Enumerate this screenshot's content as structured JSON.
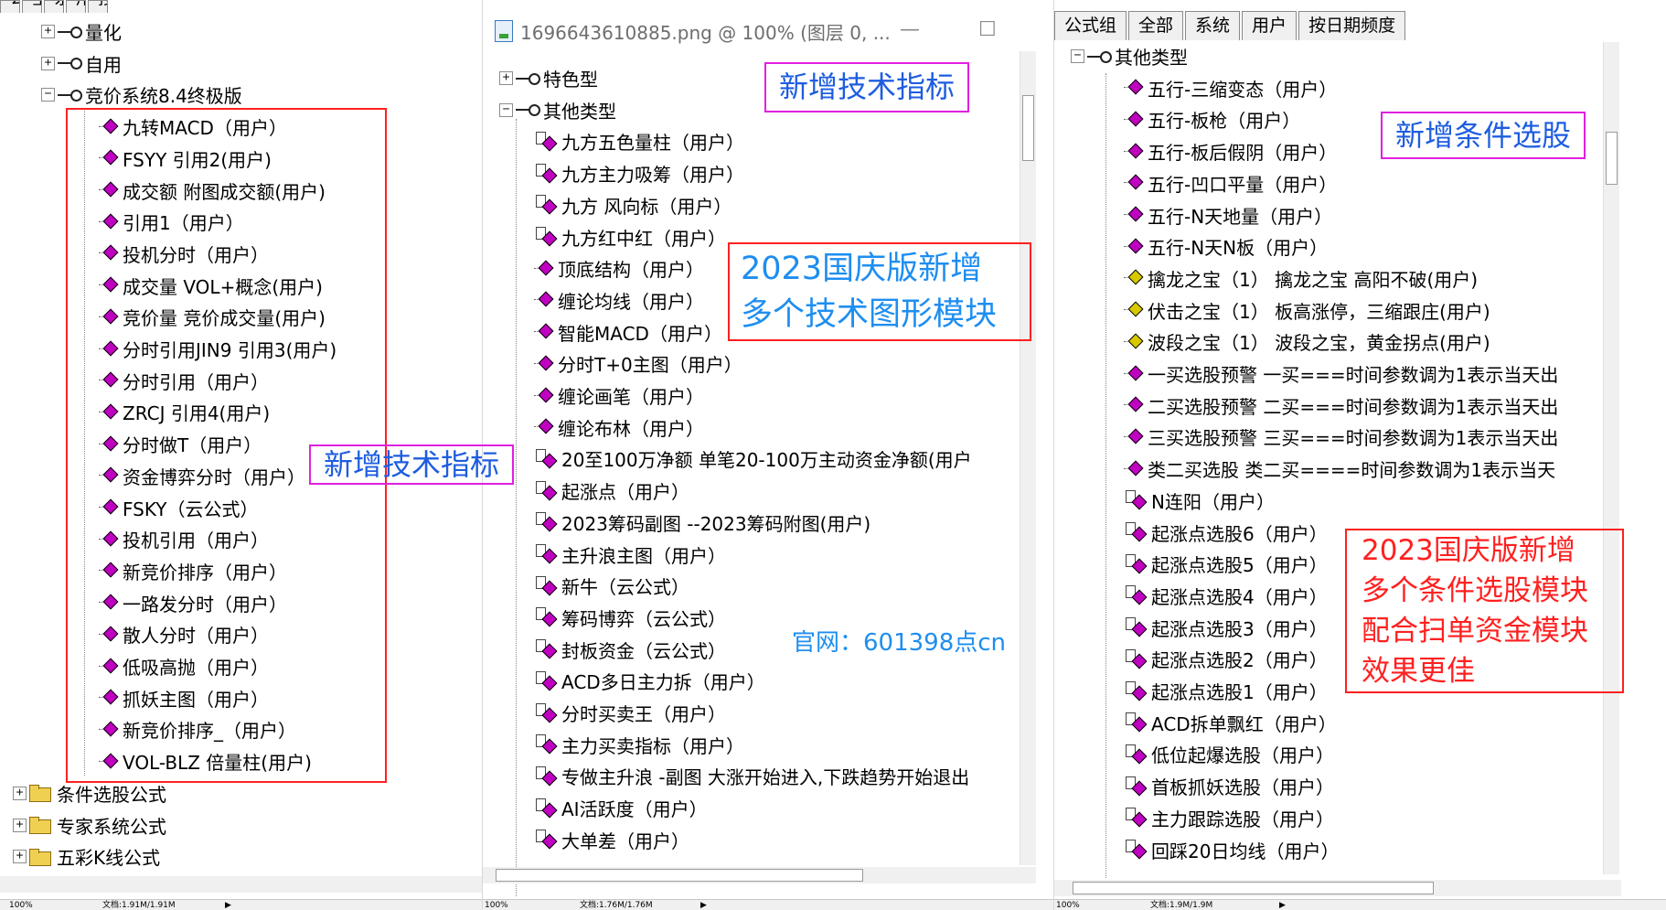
{
  "window1": {
    "tabs": [
      "公式组",
      "全部",
      "系统",
      "用户",
      "按日期频度"
    ],
    "tree": [
      {
        "label": "量化",
        "expander": "+",
        "icon": "key"
      },
      {
        "label": "自用",
        "expander": "+",
        "icon": "key"
      },
      {
        "label": "竞价系统8.4终极版",
        "expander": "−",
        "icon": "key"
      },
      {
        "label": "九转MACD（用户）",
        "icon": "gem"
      },
      {
        "label": "FSYY  引用2(用户)",
        "icon": "gem"
      },
      {
        "label": "成交额  附图成交额(用户)",
        "icon": "gem"
      },
      {
        "label": "引用1（用户）",
        "icon": "gem"
      },
      {
        "label": "投机分时（用户）",
        "icon": "gem"
      },
      {
        "label": "成交量  VOL+概念(用户)",
        "icon": "gem"
      },
      {
        "label": "竞价量  竞价成交量(用户)",
        "icon": "gem"
      },
      {
        "label": "分时引用JIN9  引用3(用户)",
        "icon": "gem"
      },
      {
        "label": "分时引用（用户）",
        "icon": "gem"
      },
      {
        "label": "ZRCJ  引用4(用户)",
        "icon": "gem"
      },
      {
        "label": "分时做T（用户）",
        "icon": "gem"
      },
      {
        "label": "资金博弈分时（用户）",
        "icon": "gem"
      },
      {
        "label": "FSKY（云公式）",
        "icon": "gem"
      },
      {
        "label": "投机引用（用户）",
        "icon": "gem"
      },
      {
        "label": "新竞价排序（用户）",
        "icon": "gem"
      },
      {
        "label": "一路发分时（用户）",
        "icon": "gem"
      },
      {
        "label": "散人分时（用户）",
        "icon": "gem"
      },
      {
        "label": "低吸高抛（用户）",
        "icon": "gem"
      },
      {
        "label": "抓妖主图（用户）",
        "icon": "gem"
      },
      {
        "label": "新竞价排序_（用户）",
        "icon": "gem"
      },
      {
        "label": "VOL-BLZ  倍量柱(用户)",
        "icon": "gem"
      },
      {
        "label": "条件选股公式",
        "expander": "+",
        "icon": "folder"
      },
      {
        "label": "专家系统公式",
        "expander": "+",
        "icon": "folder"
      },
      {
        "label": "五彩K线公式",
        "expander": "+",
        "icon": "folder"
      }
    ],
    "status": {
      "zoom": "100%",
      "doc": "文档:1.91M/1.91M"
    }
  },
  "window2": {
    "title": "1696643610885.png @ 100% (图层 0, ...",
    "minimize": "—",
    "maximize": "☐",
    "tree": [
      {
        "label": "特色型",
        "expander": "+",
        "icon": "key"
      },
      {
        "label": "其他类型",
        "expander": "−",
        "icon": "key"
      },
      {
        "label": "九方五色量柱（用户）",
        "icon": "gemdoc"
      },
      {
        "label": "九方主力吸筹（用户）",
        "icon": "gemdoc"
      },
      {
        "label": "九方 风向标（用户）",
        "icon": "gemdoc"
      },
      {
        "label": "九方红中红（用户）",
        "icon": "gemdoc"
      },
      {
        "label": "顶底结构（用户）",
        "icon": "gem"
      },
      {
        "label": "缠论均线（用户）",
        "icon": "gem"
      },
      {
        "label": "智能MACD（用户）",
        "icon": "gem"
      },
      {
        "label": "分时T+0主图（用户）",
        "icon": "gem"
      },
      {
        "label": "缠论画笔（用户）",
        "icon": "gem"
      },
      {
        "label": "缠论布林（用户）",
        "icon": "gem"
      },
      {
        "label": "20至100万净额  单笔20-100万主动资金净额(用户",
        "icon": "gemdoc"
      },
      {
        "label": "起涨点（用户）",
        "icon": "gemdoc"
      },
      {
        "label": "2023筹码副图  --2023筹码附图(用户)",
        "icon": "gemdoc"
      },
      {
        "label": "主升浪主图（用户）",
        "icon": "gemdoc"
      },
      {
        "label": "新牛（云公式）",
        "icon": "gemdoc"
      },
      {
        "label": "筹码博弈（云公式）",
        "icon": "gemdoc"
      },
      {
        "label": "封板资金（云公式）",
        "icon": "gemdoc"
      },
      {
        "label": "ACD多日主力拆（用户）",
        "icon": "gemdoc"
      },
      {
        "label": "分时买卖王（用户）",
        "icon": "gemdoc"
      },
      {
        "label": "主力买卖指标（用户）",
        "icon": "gemdoc"
      },
      {
        "label": "专做主升浪  -副图 大涨开始进入,下跌趋势开始退出",
        "icon": "gemdoc"
      },
      {
        "label": "AI活跃度（用户）",
        "icon": "gemdoc"
      },
      {
        "label": "大单差（用户）",
        "icon": "gemdoc"
      }
    ],
    "status": {
      "zoom": "100%",
      "doc": "文档:1.76M/1.76M"
    }
  },
  "window3": {
    "tabs": [
      "公式组",
      "全部",
      "系统",
      "用户",
      "按日期频度"
    ],
    "tree": [
      {
        "label": "其他类型",
        "expander": "−",
        "icon": "key"
      },
      {
        "label": "五行-三缩变态（用户）",
        "icon": "gem"
      },
      {
        "label": "五行-板枪（用户）",
        "icon": "gem"
      },
      {
        "label": "五行-板后假阴（用户）",
        "icon": "gem"
      },
      {
        "label": "五行-凹口平量（用户）",
        "icon": "gem"
      },
      {
        "label": "五行-N天地量（用户）",
        "icon": "gem"
      },
      {
        "label": "五行-N天N板（用户）",
        "icon": "gem"
      },
      {
        "label": "擒龙之宝（1）   擒龙之宝 高阳不破(用户)",
        "icon": "gem-gold"
      },
      {
        "label": "伏击之宝（1）   板高涨停，三缩跟庄(用户)",
        "icon": "gem-gold"
      },
      {
        "label": "波段之宝（1）   波段之宝，黄金拐点(用户)",
        "icon": "gem-gold"
      },
      {
        "label": "一买选股预警  一买===时间参数调为1表示当天出",
        "icon": "gem"
      },
      {
        "label": "二买选股预警  二买===时间参数调为1表示当天出",
        "icon": "gem"
      },
      {
        "label": "三买选股预警  三买===时间参数调为1表示当天出",
        "icon": "gem"
      },
      {
        "label": "类二买选股  类二买====时间参数调为1表示当天",
        "icon": "gem"
      },
      {
        "label": "N连阳（用户）",
        "icon": "gemdoc"
      },
      {
        "label": "起涨点选股6（用户）",
        "icon": "gemdoc"
      },
      {
        "label": "起涨点选股5（用户）",
        "icon": "gemdoc"
      },
      {
        "label": "起涨点选股4（用户）",
        "icon": "gemdoc"
      },
      {
        "label": "起涨点选股3（用户）",
        "icon": "gemdoc"
      },
      {
        "label": "起涨点选股2（用户）",
        "icon": "gemdoc"
      },
      {
        "label": "起涨点选股1（用户）",
        "icon": "gemdoc"
      },
      {
        "label": "ACD拆单飘红（用户）",
        "icon": "gemdoc"
      },
      {
        "label": "低位起爆选股（用户）",
        "icon": "gemdoc"
      },
      {
        "label": "首板抓妖选股（用户）",
        "icon": "gemdoc"
      },
      {
        "label": "主力跟踪选股（用户）",
        "icon": "gemdoc"
      },
      {
        "label": "回踩20日均线（用户）",
        "icon": "gemdoc"
      }
    ],
    "status": {
      "zoom": "100%",
      "doc": "文档:1.9M/1.9M"
    }
  },
  "annotations": {
    "new_indicator_left": "新增技术指标",
    "new_indicator_mid": "新增技术指标",
    "new_graphics_line1": "2023国庆版新增",
    "new_graphics_line2": "多个技术图形模块",
    "website": "官网：601398点cn",
    "new_screening": "新增条件选股",
    "new_screening_block_line1": "2023国庆版新增",
    "new_screening_block_line2": "多个条件选股模块",
    "new_screening_block_line3": "配合扫单资金模块",
    "new_screening_block_line4": "效果更佳"
  },
  "colors": {
    "annotation_frame_magenta": "#e020e0",
    "annotation_frame_red": "#ff2020",
    "annotation_text_blue": "#1e8ef0",
    "annotation_text_red": "#ff2020",
    "formula_gem": "#c000c0"
  }
}
